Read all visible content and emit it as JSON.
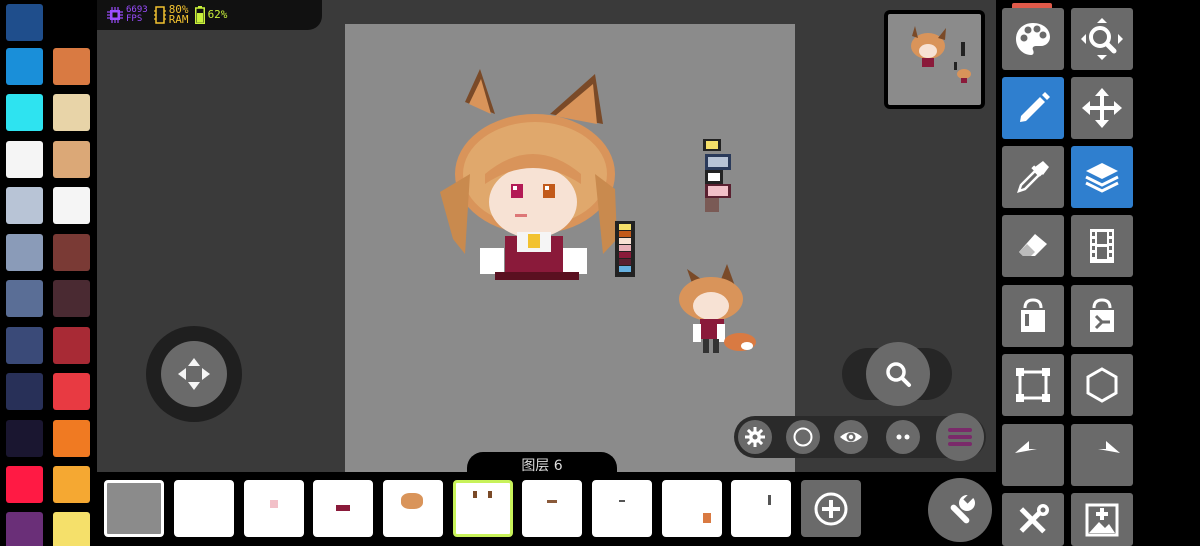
{
  "status": {
    "fps_value": "6693",
    "fps_label": "FPS",
    "ram_value": "80%",
    "ram_label": "RAM",
    "battery_value": "62%",
    "colors": {
      "fps": "#9b4dff",
      "ram": "#f2c230",
      "battery": "#c9f23a"
    }
  },
  "palette": {
    "left": [
      "#1f4e8c",
      "#1a8fd9",
      "#2ee3f0",
      "#f5f5f5",
      "#b8c4d6",
      "#8a9bb8",
      "#5a6e96",
      "#3a4a78",
      "#283058",
      "#1a1630",
      "#ff1a44",
      "#6a2f78"
    ],
    "right": [
      "#d97a42",
      "#e8d4a8",
      "#dba877",
      "#f5f5f5",
      "#7a3a35",
      "#4a2a32",
      "#a82a35",
      "#e83a42",
      "#f07a22",
      "#f5a832",
      "#f5e06a"
    ]
  },
  "layers": {
    "current_label": "图层 6",
    "count": 10,
    "selected_index": 5
  },
  "tools": [
    {
      "name": "palette-tool",
      "icon": "palette-icon",
      "active": false
    },
    {
      "name": "zoom-tool",
      "icon": "zoom-fit-icon",
      "active": false
    },
    {
      "name": "pencil-tool",
      "icon": "pencil-icon",
      "active": true
    },
    {
      "name": "move-tool",
      "icon": "move-icon",
      "active": false
    },
    {
      "name": "eyedropper-tool",
      "icon": "eyedropper-icon",
      "active": false
    },
    {
      "name": "layers-tool",
      "icon": "layers-icon",
      "active": true
    },
    {
      "name": "eraser-tool",
      "icon": "eraser-icon",
      "active": false
    },
    {
      "name": "frames-tool",
      "icon": "film-icon",
      "active": false
    },
    {
      "name": "fill-tool",
      "icon": "bucket-icon",
      "active": false
    },
    {
      "name": "fill-pattern-tool",
      "icon": "bucket-pattern-icon",
      "active": false
    },
    {
      "name": "select-rect-tool",
      "icon": "select-rect-icon",
      "active": false
    },
    {
      "name": "shape-tool",
      "icon": "hexagon-icon",
      "active": false
    },
    {
      "name": "undo-button",
      "icon": "undo-icon",
      "active": false
    },
    {
      "name": "redo-button",
      "icon": "redo-icon",
      "active": false
    },
    {
      "name": "tools-settings-button",
      "icon": "tools-icon",
      "active": false
    },
    {
      "name": "add-image-button",
      "icon": "add-image-icon",
      "active": false
    }
  ]
}
